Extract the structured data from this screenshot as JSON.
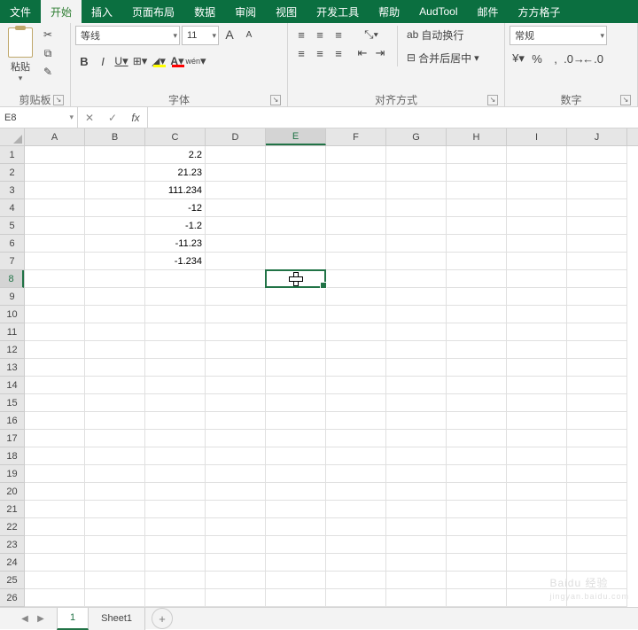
{
  "tabs": {
    "file": "文件",
    "home": "开始",
    "insert": "插入",
    "layout": "页面布局",
    "data": "数据",
    "review": "审阅",
    "view": "视图",
    "dev": "开发工具",
    "help": "帮助",
    "audtool": "AudTool",
    "mail": "邮件",
    "ffgz": "方方格子"
  },
  "active_tab": "home",
  "clipboard": {
    "paste": "粘贴",
    "label": "剪贴板"
  },
  "font": {
    "name": "等线",
    "size": "11",
    "label": "字体",
    "pinyin": "wén",
    "increase": "A",
    "decrease": "A"
  },
  "styles": {
    "B": "B",
    "I": "I",
    "U": "U"
  },
  "align": {
    "label": "对齐方式",
    "wrap": "自动换行",
    "merge": "合并后居中"
  },
  "number": {
    "label": "数字",
    "format": "常规",
    "percent": "%",
    "comma": ","
  },
  "namebox": "E8",
  "formula": "",
  "columns": [
    "A",
    "B",
    "C",
    "D",
    "E",
    "F",
    "G",
    "H",
    "I",
    "J"
  ],
  "rows": 26,
  "selected": {
    "col": 4,
    "row": 7
  },
  "cells": {
    "C1": "2.2",
    "C2": "21.23",
    "C3": "111.234",
    "C4": "-12",
    "C5": "-1.2",
    "C6": "-11.23",
    "C7": "-1.234"
  },
  "sheets": {
    "tab1": "1",
    "tab2": "Sheet1",
    "new": "+"
  },
  "watermark": {
    "brand": "Baidu 经验",
    "url": "jingyan.baidu.com"
  }
}
